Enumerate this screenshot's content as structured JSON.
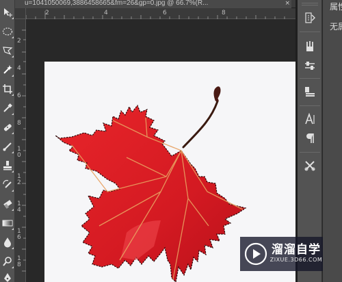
{
  "document_tab": {
    "title": "u=1041050069,3886458665&fm=26&gp=0.jpg @ 66.7%(R...",
    "close_glyph": "×"
  },
  "rulers": {
    "top_marks": [
      "2",
      "4",
      "6",
      "8"
    ],
    "left_marks": [
      "2",
      "4",
      "6",
      "8",
      "1\n0",
      "1\n2",
      "1\n4",
      "1\n6",
      "1\n8"
    ]
  },
  "toolbar": {
    "tools": [
      "move-tool",
      "marquee-tool",
      "lasso-tool",
      "magic-wand-tool",
      "crop-tool",
      "eyedropper-tool",
      "healing-brush-tool",
      "brush-tool",
      "clone-stamp-tool",
      "history-brush-tool",
      "eraser-tool",
      "gradient-tool",
      "blur-tool",
      "dodge-tool",
      "pen-tool"
    ]
  },
  "right_panel": {
    "buttons": [
      "history-icon",
      "brush-presets-icon",
      "adjustments-icon",
      "layers-icon",
      "character-icon",
      "paragraph-icon",
      "tools-icon"
    ]
  },
  "properties_panel": {
    "title": "属性",
    "value": "无属性"
  },
  "watermark": {
    "brand": "溜溜自学",
    "url": "ZIXUE.3D66.COM"
  },
  "colors": {
    "leaf_red": "#d41a22",
    "leaf_vein": "#e8a060",
    "canvas_bg": "#f6f6f8",
    "workspace_bg": "#282828",
    "panel_bg": "#535353"
  }
}
